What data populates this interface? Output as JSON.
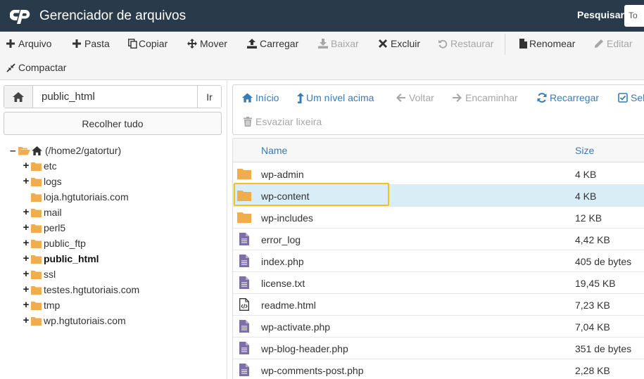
{
  "header": {
    "title": "Gerenciador de arquivos",
    "search_label": "Pesquisar",
    "search_value": "To"
  },
  "toolbar": {
    "buttons": [
      {
        "label": "Arquivo",
        "icon": "plus-icon",
        "enabled": true
      },
      {
        "label": "Pasta",
        "icon": "plus-icon",
        "enabled": true
      },
      {
        "label": "Copiar",
        "icon": "copy-icon",
        "enabled": true
      },
      {
        "label": "Mover",
        "icon": "move-icon",
        "enabled": true
      },
      {
        "label": "Carregar",
        "icon": "upload-icon",
        "enabled": true
      },
      {
        "label": "Baixar",
        "icon": "download-icon",
        "enabled": false
      },
      {
        "label": "Excluir",
        "icon": "times-icon",
        "enabled": true
      },
      {
        "label": "Restaurar",
        "icon": "undo-icon",
        "enabled": false
      },
      {
        "label": "Renomear",
        "icon": "file-icon",
        "enabled": true
      },
      {
        "label": "Editar",
        "icon": "pencil-icon",
        "enabled": false
      },
      {
        "label": "Compactar",
        "icon": "compress-icon",
        "enabled": true
      }
    ]
  },
  "left_pane": {
    "path_value": "public_html",
    "go_label": "Ir",
    "collapse_label": "Recolher tudo",
    "tree": {
      "root_label": "(/home2/gatortur)",
      "items": [
        {
          "label": "etc",
          "expandable": true,
          "bold": false
        },
        {
          "label": "logs",
          "expandable": true,
          "bold": false
        },
        {
          "label": "loja.hgtutoriais.com",
          "expandable": false,
          "bold": false
        },
        {
          "label": "mail",
          "expandable": true,
          "bold": false
        },
        {
          "label": "perl5",
          "expandable": true,
          "bold": false
        },
        {
          "label": "public_ftp",
          "expandable": true,
          "bold": false
        },
        {
          "label": "public_html",
          "expandable": true,
          "bold": true
        },
        {
          "label": "ssl",
          "expandable": true,
          "bold": false
        },
        {
          "label": "testes.hgtutoriais.com",
          "expandable": true,
          "bold": false
        },
        {
          "label": "tmp",
          "expandable": true,
          "bold": false
        },
        {
          "label": "wp.hgtutoriais.com",
          "expandable": true,
          "bold": false
        }
      ]
    }
  },
  "right_pane": {
    "toolbar": [
      {
        "label": "Início",
        "icon": "home-icon",
        "enabled": true
      },
      {
        "label": "Um nível acima",
        "icon": "level-up-icon",
        "enabled": true
      },
      {
        "label": "Voltar",
        "icon": "arrow-left-icon",
        "enabled": false
      },
      {
        "label": "Encaminhar",
        "icon": "arrow-right-icon",
        "enabled": false
      },
      {
        "label": "Recarregar",
        "icon": "refresh-icon",
        "enabled": true
      },
      {
        "label": "Sele",
        "icon": "check-square-icon",
        "enabled": true
      },
      {
        "label": "Esvaziar lixeira",
        "icon": "trash-icon",
        "enabled": false
      }
    ],
    "columns": {
      "name": "Name",
      "size": "Size"
    },
    "files": [
      {
        "name": "wp-admin",
        "size": "4 KB",
        "type": "folder"
      },
      {
        "name": "wp-content",
        "size": "4 KB",
        "type": "folder",
        "selected": true
      },
      {
        "name": "wp-includes",
        "size": "12 KB",
        "type": "folder"
      },
      {
        "name": "error_log",
        "size": "4,42 KB",
        "type": "file"
      },
      {
        "name": "index.php",
        "size": "405 de bytes",
        "type": "file"
      },
      {
        "name": "license.txt",
        "size": "19,45 KB",
        "type": "file"
      },
      {
        "name": "readme.html",
        "size": "7,23 KB",
        "type": "code"
      },
      {
        "name": "wp-activate.php",
        "size": "7,04 KB",
        "type": "file"
      },
      {
        "name": "wp-blog-header.php",
        "size": "351 de bytes",
        "type": "file"
      },
      {
        "name": "wp-comments-post.php",
        "size": "2,28 KB",
        "type": "file"
      }
    ]
  },
  "colors": {
    "header_bg": "#293a4a",
    "link_blue": "#3a7ab5",
    "folder": "#f0ad4e",
    "file": "#7e6fa8",
    "selected_row": "#d9edf7",
    "highlight": "#f0c419"
  }
}
